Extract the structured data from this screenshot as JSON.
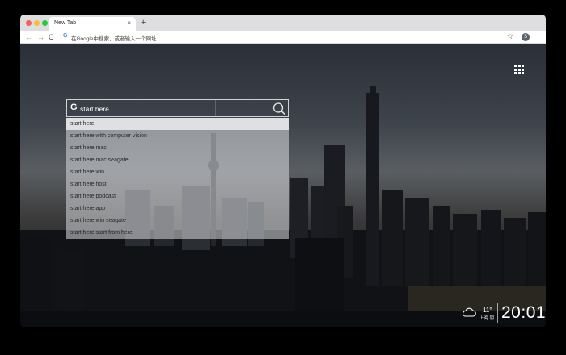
{
  "tab": {
    "title": "New Tab",
    "close": "×",
    "new_tab": "+"
  },
  "toolbar": {
    "back": "←",
    "forward": "→",
    "reload": "C",
    "omnibox_text": "在Google中搜索，或者输入一个网址",
    "bookmark_star": "☆",
    "profile_initial": "S",
    "menu": "⋮"
  },
  "search": {
    "logo": "G",
    "query": "start here",
    "suggestions": [
      "start here",
      "start here with computer vision",
      "start here mac",
      "start here mac seagate",
      "start here win",
      "start here host",
      "start here podcast",
      "start here app",
      "start here win seagate",
      "start here start from here"
    ]
  },
  "weather": {
    "temperature": "11°",
    "location": "上海 阴",
    "icon": "cloud-icon"
  },
  "clock": {
    "time": "20:01"
  },
  "colors": {
    "overlay": "#dadce0",
    "accent": "#4285f4"
  }
}
